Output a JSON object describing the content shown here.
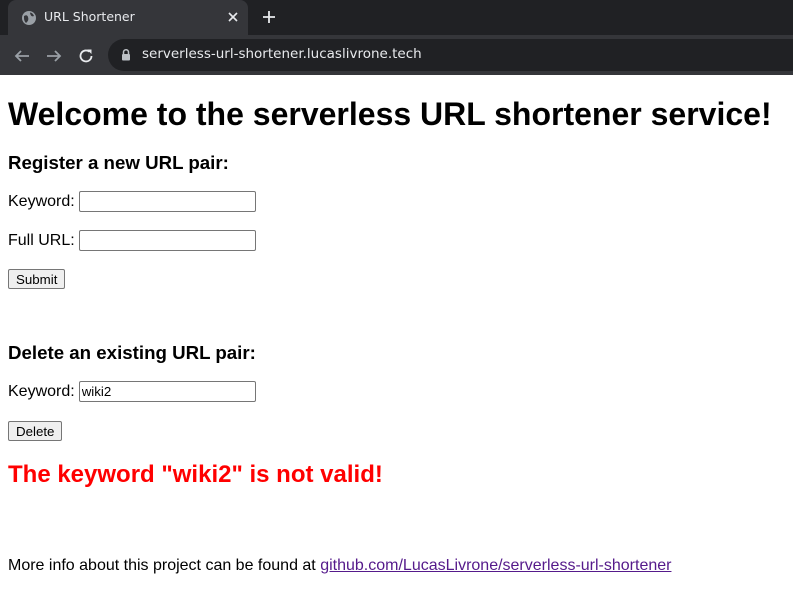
{
  "browser": {
    "tab_title": "URL Shortener",
    "url": "serverless-url-shortener.lucaslivrone.tech"
  },
  "page": {
    "heading": "Welcome to the serverless URL shortener service!",
    "register": {
      "heading": "Register a new URL pair:",
      "keyword_label": "Keyword:",
      "keyword_value": "",
      "full_url_label": "Full URL:",
      "full_url_value": "",
      "submit_label": "Submit"
    },
    "delete": {
      "heading": "Delete an existing URL pair:",
      "keyword_label": "Keyword:",
      "keyword_value": "wiki2",
      "delete_label": "Delete"
    },
    "error_message": "The keyword \"wiki2\" is not valid!",
    "footer": {
      "text": "More info about this project can be found at ",
      "link_text": "github.com/LucasLivrone/serverless-url-shortener"
    }
  },
  "colors": {
    "error": "#ff0000",
    "visited_link": "#551a8b",
    "chrome_dark": "#202124",
    "chrome_tab": "#35363a"
  }
}
